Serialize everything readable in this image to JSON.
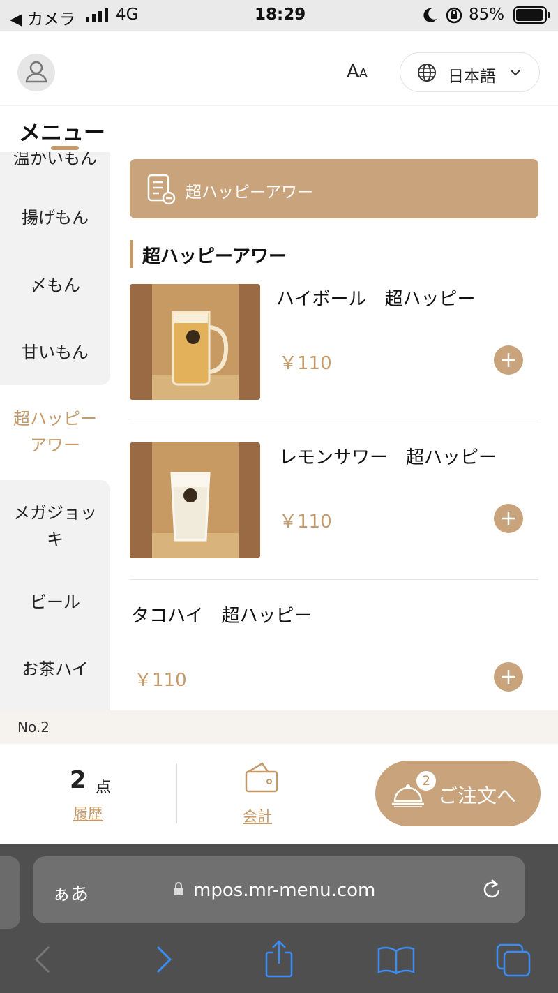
{
  "status_bar": {
    "back_label": "◀ カメラ",
    "network": "4G",
    "time": "18:29",
    "battery": "85%"
  },
  "header": {
    "font_size_label": "A",
    "font_size_label_small": "A",
    "language": "日本語"
  },
  "sidebar": {
    "title": "メニュー",
    "categories": [
      {
        "label": "温かいもん",
        "active": false
      },
      {
        "label": "揚げもん",
        "active": false
      },
      {
        "label": "〆もん",
        "active": false
      },
      {
        "label": "甘いもん",
        "active": false
      },
      {
        "label": "超ハッピーアワー",
        "line1": "超ハッピー",
        "line2": "アワー",
        "active": true
      },
      {
        "label": "メガジョッキ",
        "line1": "メガジョッ",
        "line2": "キ",
        "active": false
      },
      {
        "label": "ビール",
        "active": false
      },
      {
        "label": "お茶ハイ",
        "active": false
      }
    ]
  },
  "content": {
    "banner_label": "超ハッピーアワー",
    "section_title": "超ハッピーアワー",
    "items": [
      {
        "name": "ハイボール　超ハッピー",
        "price": "￥110"
      },
      {
        "name": "レモンサワー　超ハッピー",
        "price": "￥110"
      },
      {
        "name": "タコハイ　超ハッピー",
        "price": "￥110"
      }
    ]
  },
  "table_no": "No.2",
  "bottom_bar": {
    "count": "2",
    "count_unit": "点",
    "history_label": "履歴",
    "checkout_label": "会計",
    "order_label": "ご注文へ",
    "order_badge": "2"
  },
  "browser": {
    "aa_label": "ぁあ",
    "url": "mpos.mr-menu.com"
  },
  "colors": {
    "accent": "#c49a6a",
    "accent_fill": "#c9a37b",
    "sidebar_bg": "#f2f2f2"
  },
  "icons": [
    "signal-icon",
    "moon-icon",
    "rotation-lock-icon",
    "battery-icon",
    "user-icon",
    "globe-icon",
    "chevron-down-icon",
    "menu-list-icon",
    "plus-icon",
    "wallet-icon",
    "bell-icon",
    "lock-icon",
    "reload-icon",
    "back-arrow-icon",
    "forward-arrow-icon",
    "share-icon",
    "bookmarks-icon",
    "tabs-icon"
  ]
}
